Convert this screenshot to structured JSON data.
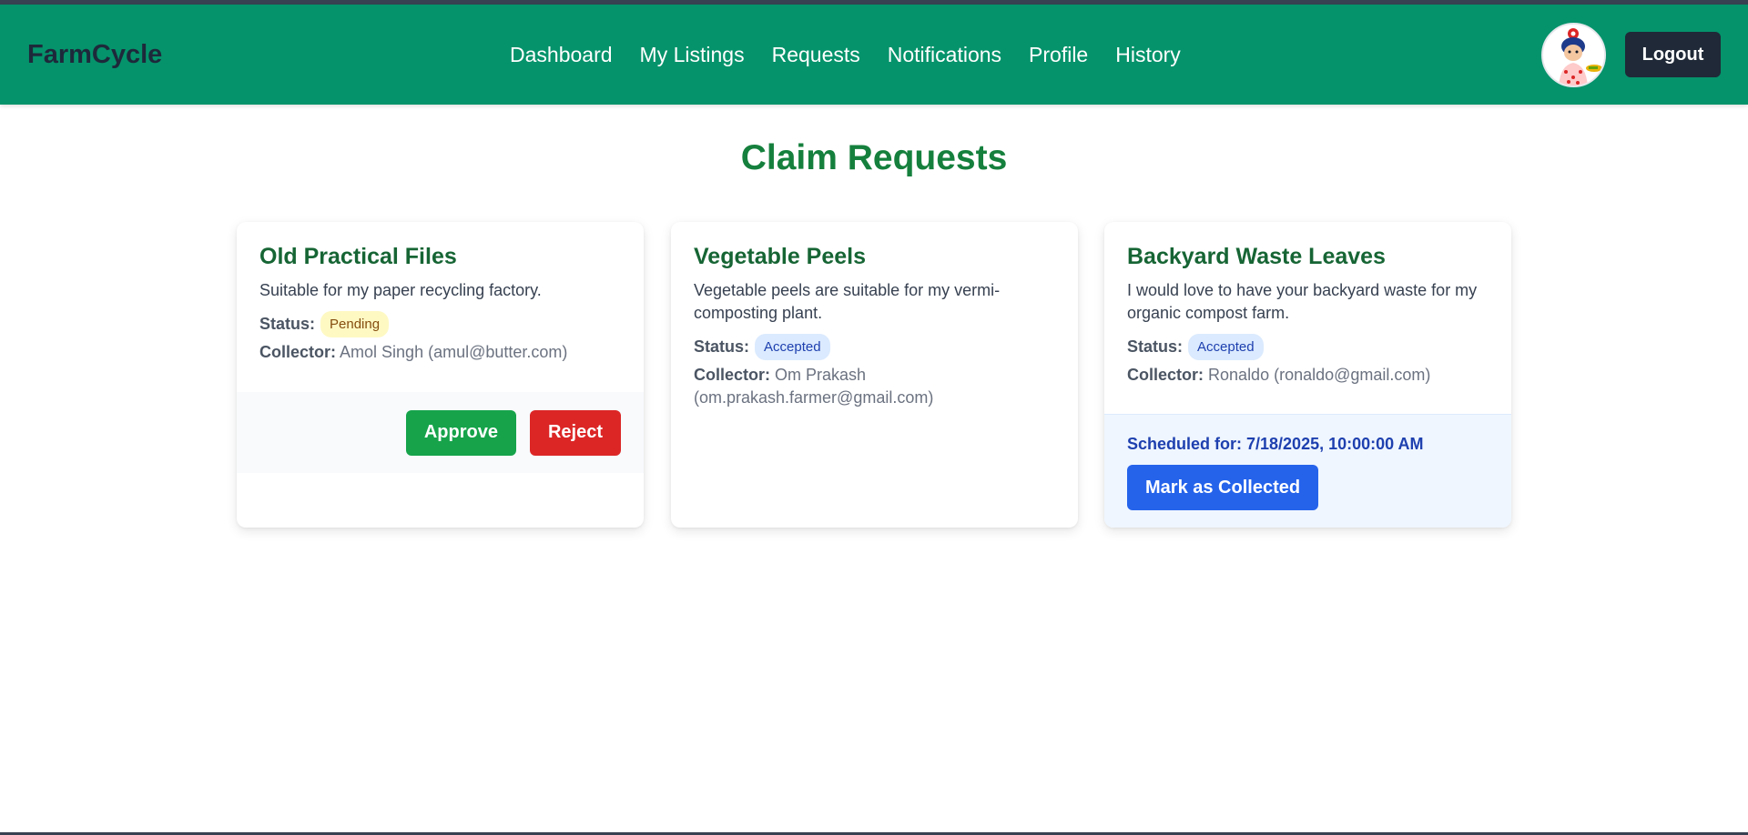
{
  "app": {
    "brand": "FarmCycle"
  },
  "nav": {
    "links": [
      "Dashboard",
      "My Listings",
      "Requests",
      "Notifications",
      "Profile",
      "History"
    ],
    "logout_label": "Logout",
    "avatar_icon": "user-avatar-icon"
  },
  "page": {
    "title": "Claim Requests"
  },
  "labels": {
    "status": "Status:",
    "collector": "Collector:"
  },
  "requests": [
    {
      "title": "Old Practical Files",
      "description": "Suitable for my paper recycling factory.",
      "status": "Pending",
      "collector": "Amol Singh (amul@butter.com)",
      "approve_label": "Approve",
      "reject_label": "Reject"
    },
    {
      "title": "Vegetable Peels",
      "description": "Vegetable peels are suitable for my vermi-composting plant.",
      "status": "Accepted",
      "collector": "Om Prakash (om.prakash.farmer@gmail.com)"
    },
    {
      "title": "Backyard Waste Leaves",
      "description": "I would love to have your backyard waste for my organic compost farm.",
      "status": "Accepted",
      "collector": "Ronaldo (ronaldo@gmail.com)",
      "schedule": "Scheduled for: 7/18/2025, 10:00:00 AM",
      "collect_label": "Mark as Collected"
    }
  ],
  "colors": {
    "navbar": "#05936b",
    "title_green": "#15803d",
    "approve": "#16a34a",
    "reject": "#dc2626",
    "collect": "#2563eb"
  }
}
